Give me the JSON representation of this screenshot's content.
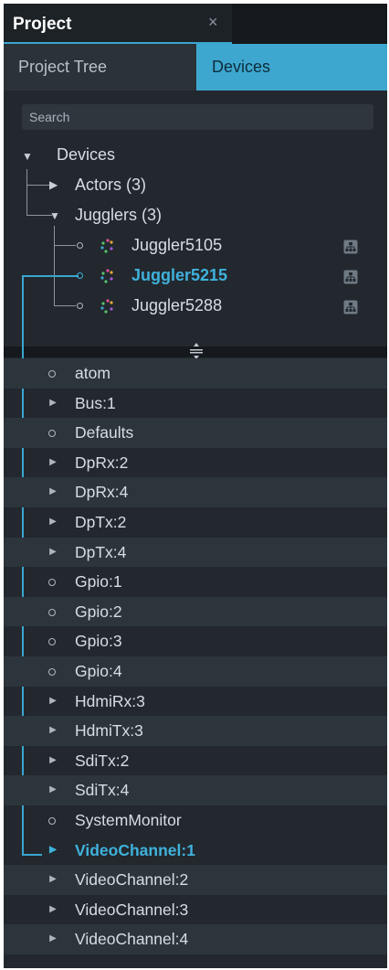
{
  "header": {
    "title": "Project",
    "close_glyph": "×"
  },
  "tabs": [
    {
      "label": "Project Tree",
      "active": false
    },
    {
      "label": "Devices",
      "active": true
    }
  ],
  "search": {
    "placeholder": "Search",
    "value": ""
  },
  "tree": {
    "root": "Devices",
    "groups": [
      {
        "label": "Actors (3)",
        "expanded": false
      },
      {
        "label": "Jugglers (3)",
        "expanded": true
      }
    ],
    "jugglers": [
      {
        "label": "Juggler5105",
        "selected": false
      },
      {
        "label": "Juggler5215",
        "selected": true
      },
      {
        "label": "Juggler5288",
        "selected": false
      }
    ]
  },
  "list": [
    {
      "label": "atom",
      "kind": "leaf"
    },
    {
      "label": "Bus:1",
      "kind": "branch"
    },
    {
      "label": "Defaults",
      "kind": "leaf"
    },
    {
      "label": "DpRx:2",
      "kind": "branch"
    },
    {
      "label": "DpRx:4",
      "kind": "branch"
    },
    {
      "label": "DpTx:2",
      "kind": "branch"
    },
    {
      "label": "DpTx:4",
      "kind": "branch"
    },
    {
      "label": "Gpio:1",
      "kind": "leaf"
    },
    {
      "label": "Gpio:2",
      "kind": "leaf"
    },
    {
      "label": "Gpio:3",
      "kind": "leaf"
    },
    {
      "label": "Gpio:4",
      "kind": "leaf"
    },
    {
      "label": "HdmiRx:3",
      "kind": "branch"
    },
    {
      "label": "HdmiTx:3",
      "kind": "branch"
    },
    {
      "label": "SdiTx:2",
      "kind": "branch"
    },
    {
      "label": "SdiTx:4",
      "kind": "branch"
    },
    {
      "label": "SystemMonitor",
      "kind": "leaf"
    },
    {
      "label": "VideoChannel:1",
      "kind": "branch",
      "selected": true
    },
    {
      "label": "VideoChannel:2",
      "kind": "branch"
    },
    {
      "label": "VideoChannel:3",
      "kind": "branch"
    },
    {
      "label": "VideoChannel:4",
      "kind": "branch"
    }
  ],
  "icons": {
    "close": "close-icon",
    "expanded": "triangle-down-icon",
    "collapsed": "triangle-right-icon",
    "juggler": "juggler-device-icon",
    "network": "network-icon",
    "splitter": "splitter-grip-icon",
    "leaf": "circle-icon"
  },
  "colors": {
    "accent": "#3ea7cf",
    "selected_text": "#3fb2dc",
    "background": "#22282e",
    "row_alt": "#2d353c"
  }
}
